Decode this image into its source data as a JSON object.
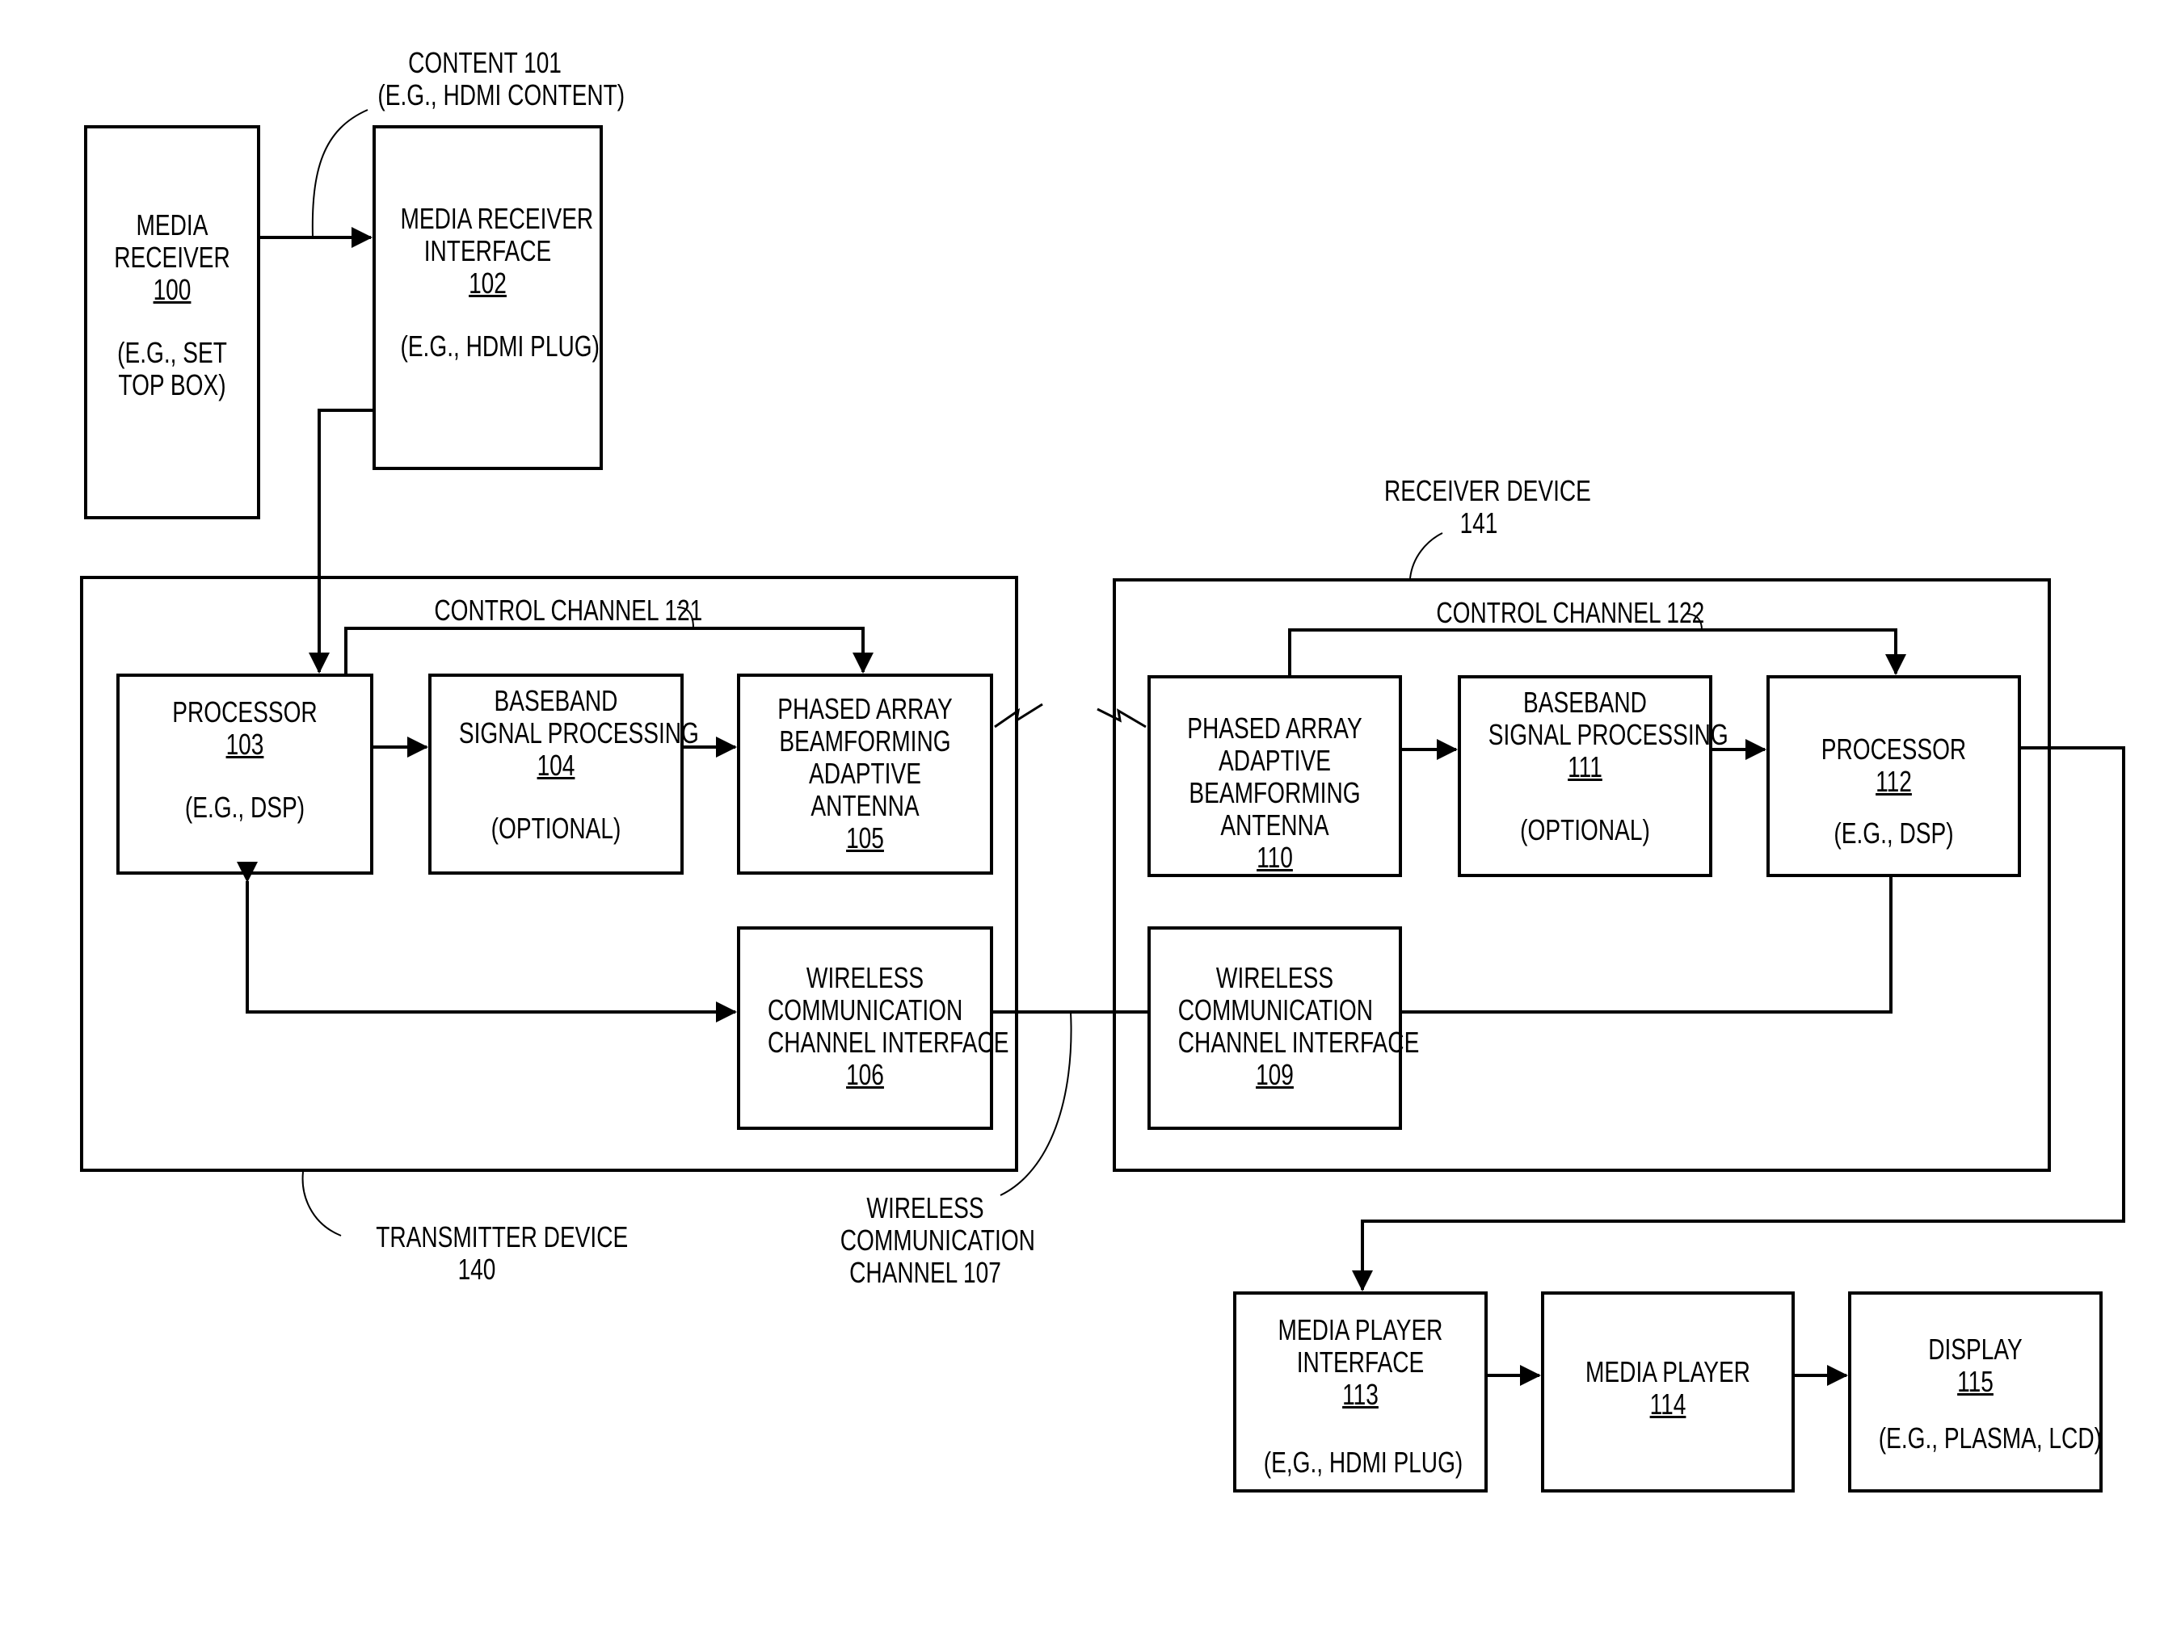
{
  "figure": {
    "blocks": {
      "media_receiver": {
        "lines": [
          "MEDIA",
          "RECEIVER"
        ],
        "ref": "100",
        "example": [
          "(E.G., SET",
          "TOP BOX)"
        ]
      },
      "media_receiver_interface": {
        "lines": [
          "MEDIA RECEIVER",
          "INTERFACE"
        ],
        "ref": "102",
        "example": [
          "(E.G., HDMI PLUG)"
        ]
      },
      "processor_103": {
        "lines": [
          "PROCESSOR"
        ],
        "ref": "103",
        "example": [
          "(E.G., DSP)"
        ]
      },
      "baseband_104": {
        "lines": [
          "BASEBAND",
          "SIGNAL PROCESSING"
        ],
        "ref": "104",
        "example": [
          "(OPTIONAL)"
        ]
      },
      "phased_array_105": {
        "lines": [
          "PHASED ARRAY",
          "BEAMFORMING",
          "ADAPTIVE",
          "ANTENNA"
        ],
        "ref": "105"
      },
      "wireless_interface_106": {
        "lines": [
          "WIRELESS",
          "COMMUNICATION",
          "CHANNEL INTERFACE"
        ],
        "ref": "106"
      },
      "phased_array_110": {
        "lines": [
          "PHASED ARRAY",
          "ADAPTIVE",
          "BEAMFORMING",
          "ANTENNA"
        ],
        "ref": "110"
      },
      "baseband_111": {
        "lines": [
          "BASEBAND",
          "SIGNAL PROCESSING"
        ],
        "ref": "111",
        "example": [
          "(OPTIONAL)"
        ]
      },
      "processor_112": {
        "lines": [
          "PROCESSOR"
        ],
        "ref": "112",
        "example": [
          "(E.G., DSP)"
        ]
      },
      "wireless_interface_109": {
        "lines": [
          "WIRELESS",
          "COMMUNICATION",
          "CHANNEL INTERFACE"
        ],
        "ref": "109"
      },
      "media_player_interface": {
        "lines": [
          "MEDIA PLAYER",
          "INTERFACE"
        ],
        "ref": "113",
        "example": [
          "(E,G., HDMI PLUG)"
        ]
      },
      "media_player": {
        "lines": [
          "MEDIA PLAYER"
        ],
        "ref": "114"
      },
      "display": {
        "lines": [
          "DISPLAY"
        ],
        "ref": "115",
        "example": [
          "(E.G., PLASMA, LCD)"
        ]
      }
    },
    "annotations": {
      "content": [
        "CONTENT 101",
        "(E.G., HDMI CONTENT)"
      ],
      "control_channel_121": "CONTROL CHANNEL 121",
      "control_channel_122": "CONTROL CHANNEL 122",
      "receiver_device": [
        "RECEIVER DEVICE",
        "141"
      ],
      "transmitter_device": [
        "TRANSMITTER DEVICE",
        "140"
      ],
      "wireless_channel": [
        "WIRELESS",
        "COMMUNICATION",
        "CHANNEL 107"
      ]
    }
  }
}
